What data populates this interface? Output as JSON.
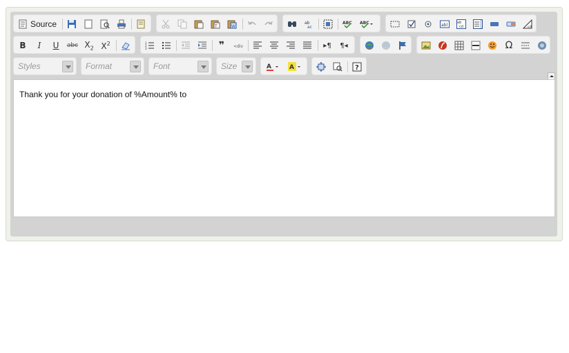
{
  "toolbar": {
    "source_label": "Source",
    "styles_placeholder": "Styles",
    "format_placeholder": "Format",
    "font_placeholder": "Font",
    "size_placeholder": "Size"
  },
  "content": {
    "text": "Thank you for your donation of %Amount% to"
  },
  "colors": {
    "frame": "#eef2ea",
    "editor_bg": "#d3d3d3",
    "group_bg": "#f2f2f2",
    "text_color_accent": "#e53935",
    "bg_color_accent": "#f4e13a"
  },
  "icons": {
    "row1": [
      "document-icon",
      "save-icon",
      "new-page-icon",
      "preview-icon",
      "print-icon",
      "templates-icon",
      "cut-icon",
      "copy-icon",
      "paste-icon",
      "paste-text-icon",
      "paste-word-icon",
      "undo-icon",
      "redo-icon",
      "find-icon",
      "replace-icon",
      "select-all-icon",
      "spellcheck-icon",
      "spellcheck-as-you-type-icon",
      "form-icon",
      "checkbox-icon",
      "radio-icon",
      "textfield-icon",
      "textarea-icon",
      "select-icon",
      "button-icon",
      "image-button-icon",
      "hidden-field-icon"
    ],
    "row2": [
      "bold-icon",
      "italic-icon",
      "underline-icon",
      "strike-icon",
      "subscript-icon",
      "superscript-icon",
      "remove-format-icon",
      "numbered-list-icon",
      "bulleted-list-icon",
      "outdent-icon",
      "indent-icon",
      "blockquote-icon",
      "div-icon",
      "align-left-icon",
      "align-center-icon",
      "align-right-icon",
      "justify-icon",
      "ltr-icon",
      "rtl-icon",
      "link-icon",
      "unlink-icon",
      "anchor-icon",
      "image-icon",
      "flash-icon",
      "table-icon",
      "horizontal-rule-icon",
      "smiley-icon",
      "special-char-icon",
      "page-break-icon",
      "iframe-icon"
    ],
    "row3": [
      "text-color-icon",
      "bg-color-icon",
      "maximize-icon",
      "show-blocks-icon",
      "about-icon",
      "collapse-toolbar-icon"
    ]
  }
}
